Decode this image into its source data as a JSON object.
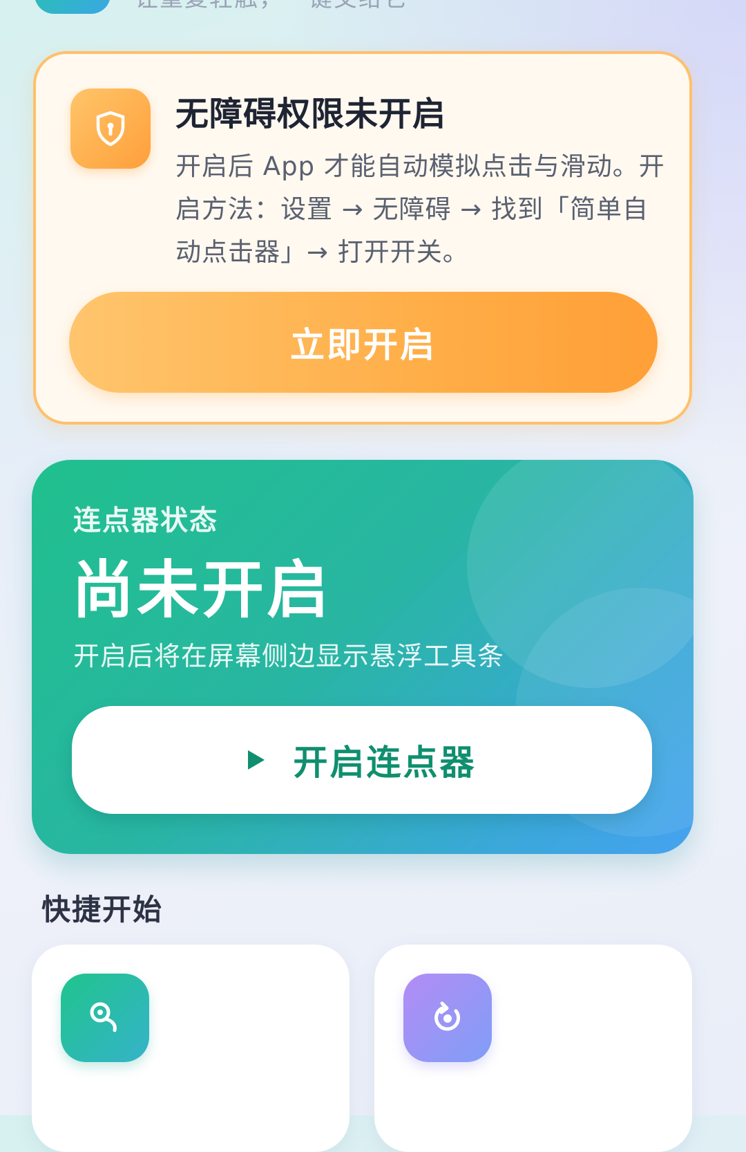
{
  "header": {
    "subtitle": "让重复轻触，一键交给它",
    "logo_icon": "app-logo-icon"
  },
  "accessibility_card": {
    "icon": "shield-icon",
    "title": "无障碍权限未开启",
    "description": "开启后 App 才能自动模拟点击与滑动。开启方法：设置 → 无障碍 → 找到「简单自动点击器」→ 打开开关。",
    "button_label": "立即开启",
    "accent_color": "#ffa940"
  },
  "clicker_status_card": {
    "label": "连点器状态",
    "status": "尚未开启",
    "hint": "开启后将在屏幕侧边显示悬浮工具条",
    "button_icon": "play-icon",
    "button_label": "开启连点器",
    "accent_color": "#22b894"
  },
  "quick_start": {
    "title": "快捷开始",
    "cards": [
      {
        "icon": "tap-point-icon",
        "color": "#22c08e"
      },
      {
        "icon": "loop-record-icon",
        "color": "#9b93f6"
      }
    ]
  }
}
